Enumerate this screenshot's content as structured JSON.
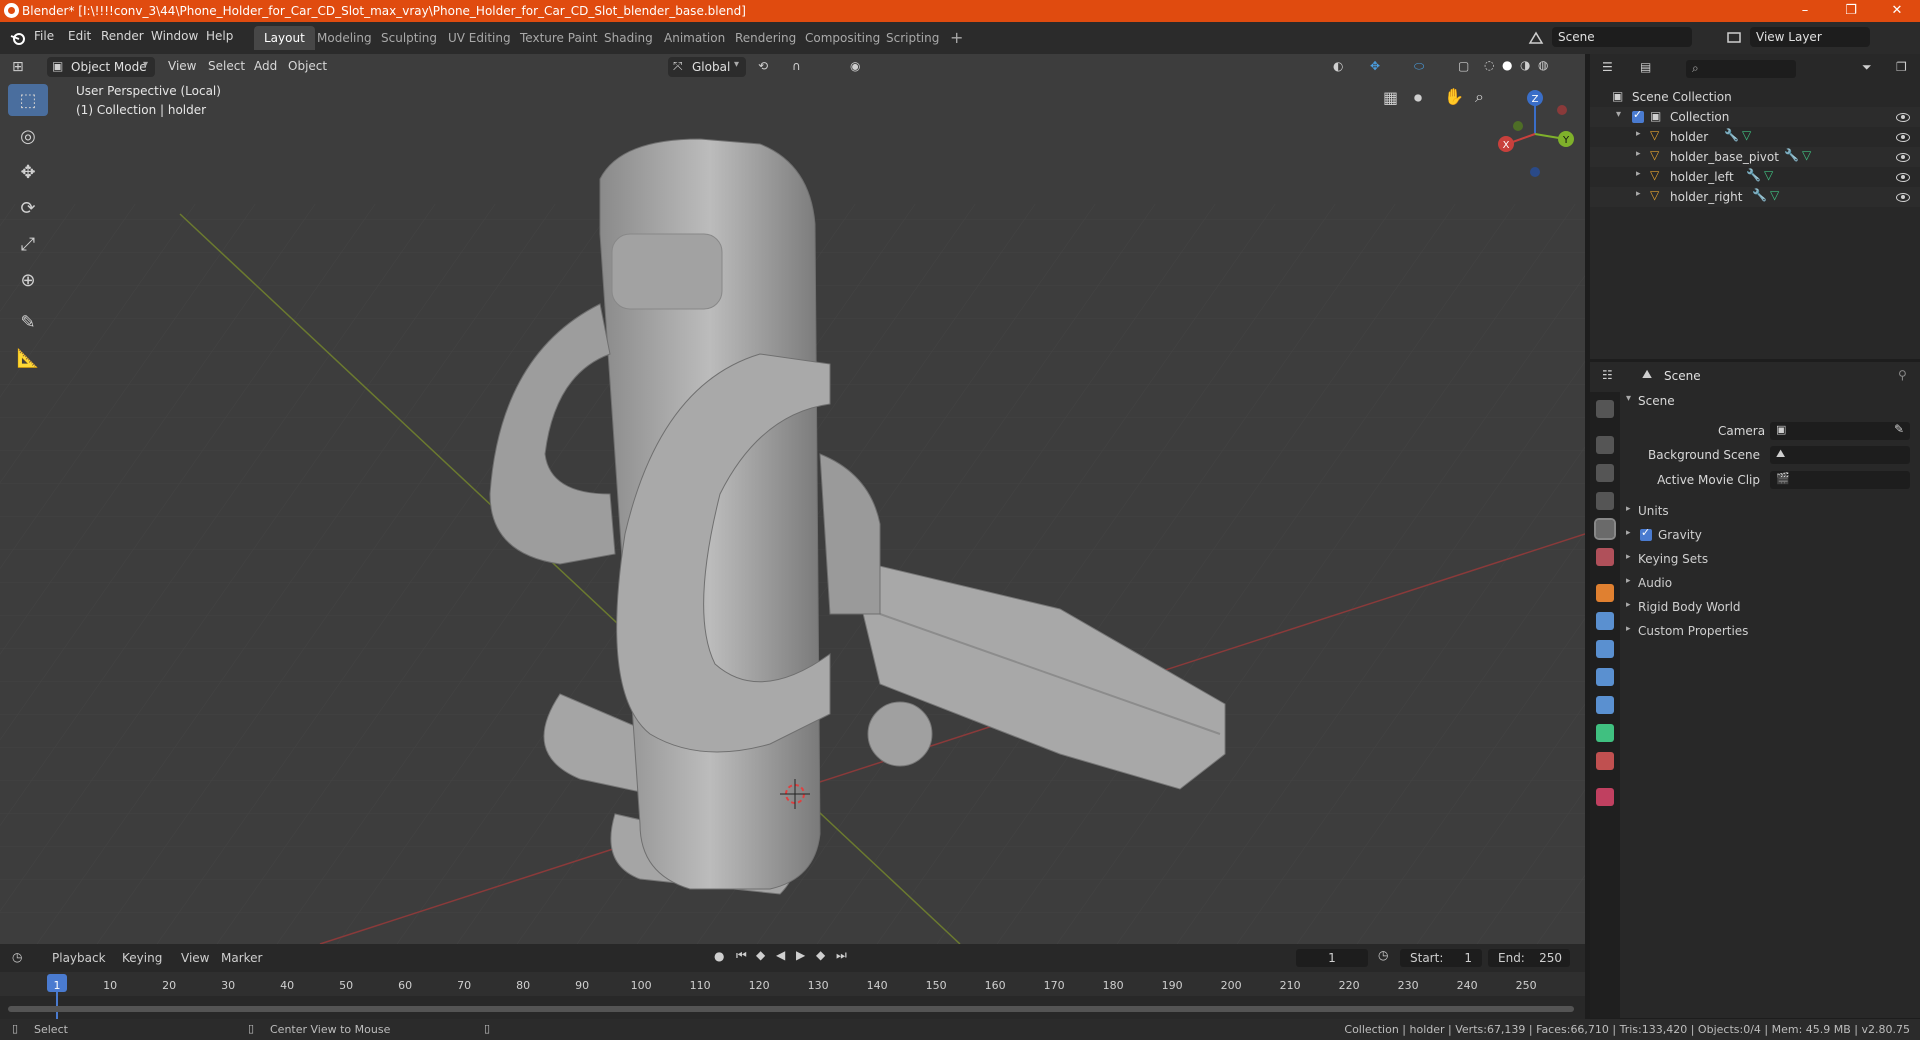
{
  "window": {
    "title": "Blender* [I:\\!!!!conv_3\\44\\Phone_Holder_for_Car_CD_Slot_max_vray\\Phone_Holder_for_Car_CD_Slot_blender_base.blend]",
    "minimize": "–",
    "maximize": "❐",
    "close": "✕"
  },
  "menu": [
    "File",
    "Edit",
    "Render",
    "Window",
    "Help"
  ],
  "workspaces": [
    "Layout",
    "Modeling",
    "Sculpting",
    "UV Editing",
    "Texture Paint",
    "Shading",
    "Animation",
    "Rendering",
    "Compositing",
    "Scripting"
  ],
  "workspace_add": "+",
  "active_workspace": "Layout",
  "top_right": {
    "scene": "Scene",
    "view_layer": "View Layer"
  },
  "viewport_header": {
    "mode": "Object Mode",
    "menus": [
      "View",
      "Select",
      "Add",
      "Object"
    ],
    "orientation": "Global"
  },
  "viewport": {
    "perspective": "User Perspective (Local)",
    "collection": "(1) Collection | holder",
    "gizmo": {
      "x": "X",
      "y": "Y",
      "z": "Z"
    }
  },
  "outliner": {
    "search_placeholder": "",
    "scene_collection": "Scene Collection",
    "collection": "Collection",
    "objects": [
      "holder",
      "holder_base_pivot",
      "holder_left",
      "holder_right"
    ]
  },
  "properties": {
    "context": "Scene",
    "section": "Scene",
    "fields": [
      {
        "label": "Camera",
        "value": ""
      },
      {
        "label": "Background Scene",
        "value": ""
      },
      {
        "label": "Active Movie Clip",
        "value": ""
      }
    ],
    "panels": [
      "Units",
      "Gravity",
      "Keying Sets",
      "Audio",
      "Rigid Body World",
      "Custom Properties"
    ]
  },
  "timeline": {
    "menus": [
      "Playback",
      "Keying",
      "View",
      "Marker"
    ],
    "current_frame": "1",
    "start_label": "Start:",
    "start": "1",
    "end_label": "End:",
    "end": "250",
    "ticks": [
      "1",
      "10",
      "20",
      "30",
      "40",
      "50",
      "60",
      "70",
      "80",
      "90",
      "100",
      "110",
      "120",
      "130",
      "140",
      "150",
      "160",
      "170",
      "180",
      "190",
      "200",
      "210",
      "220",
      "230",
      "240",
      "250"
    ]
  },
  "statusbar": {
    "left": "Select",
    "middle": "Center View to Mouse",
    "right": "Collection | holder | Verts:67,139 | Faces:66,710 | Tris:133,420 | Objects:0/4 | Mem: 45.9 MB | v2.80.75"
  },
  "colors": {
    "titlebar": "#e04b0f",
    "accent": "#4a7bd0",
    "viewport_bg": "#3d3d3d",
    "object_orange": "#e0a030"
  }
}
